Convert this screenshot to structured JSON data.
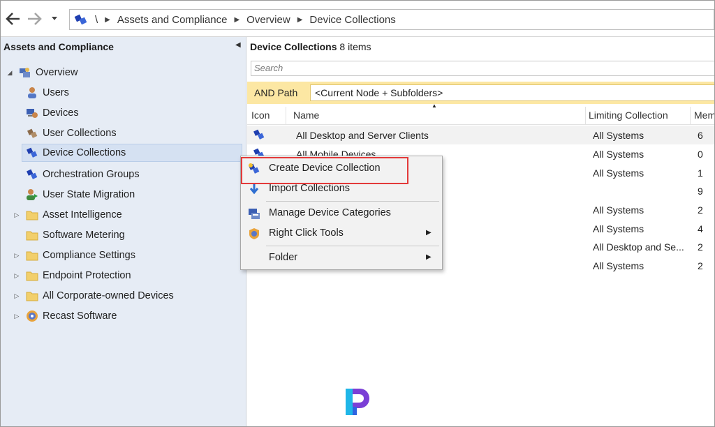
{
  "address_bar": {
    "breadcrumbs": [
      "\\",
      "Assets and Compliance",
      "Overview",
      "Device Collections"
    ]
  },
  "left_pane": {
    "title": "Assets and Compliance",
    "tree": [
      {
        "label": "Overview",
        "icon": "overview-icon",
        "expanded": true,
        "level": 0
      },
      {
        "label": "Users",
        "icon": "users-icon",
        "level": 1
      },
      {
        "label": "Devices",
        "icon": "devices-icon",
        "level": 1
      },
      {
        "label": "User Collections",
        "icon": "user-collections-icon",
        "level": 1
      },
      {
        "label": "Device Collections",
        "icon": "device-collections-icon",
        "level": 1,
        "selected": true
      },
      {
        "label": "Orchestration Groups",
        "icon": "orchestration-groups-icon",
        "level": 1
      },
      {
        "label": "User State Migration",
        "icon": "user-state-migration-icon",
        "level": 1
      },
      {
        "label": "Asset Intelligence",
        "icon": "folder-icon",
        "level": 1,
        "collapsed": true
      },
      {
        "label": "Software Metering",
        "icon": "folder-icon",
        "level": 1
      },
      {
        "label": "Compliance Settings",
        "icon": "folder-icon",
        "level": 1,
        "collapsed": true
      },
      {
        "label": "Endpoint Protection",
        "icon": "folder-icon",
        "level": 1,
        "collapsed": true
      },
      {
        "label": "All Corporate-owned Devices",
        "icon": "folder-icon",
        "level": 1,
        "collapsed": true
      },
      {
        "label": "Recast Software",
        "icon": "recast-icon",
        "level": 1,
        "collapsed": true
      }
    ]
  },
  "right_pane": {
    "title": "Device Collections",
    "count": "8 items",
    "search_placeholder": "Search",
    "filter": {
      "label": "AND Path",
      "value": "<Current Node + Subfolders>"
    },
    "columns": [
      "Icon",
      "Name",
      "Limiting Collection",
      "Mem"
    ],
    "rows": [
      {
        "name": "All Desktop and Server Clients",
        "limiting": "All Systems",
        "members": "6"
      },
      {
        "name": "All Mobile Devices",
        "limiting": "All Systems",
        "members": "0"
      },
      {
        "name": "",
        "limiting": "All Systems",
        "members": "1"
      },
      {
        "name": "",
        "limiting": "",
        "members": "9"
      },
      {
        "name": "",
        "limiting": "All Systems",
        "members": "2"
      },
      {
        "name": "",
        "limiting": "All Systems",
        "members": "4"
      },
      {
        "name": "",
        "limiting": "All Desktop and Se...",
        "members": "2"
      },
      {
        "name": "",
        "limiting": "All Systems",
        "members": "2"
      }
    ]
  },
  "context_menu": {
    "items": [
      {
        "label": "Create Device Collection",
        "icon": "create-collection-icon",
        "highlighted": true
      },
      {
        "label": "Import Collections",
        "icon": "import-arrow-icon"
      },
      {
        "label": "Manage Device Categories",
        "icon": "categories-icon"
      },
      {
        "label": "Right Click Tools",
        "icon": "right-click-tools-icon",
        "submenu": true
      },
      {
        "label": "Folder",
        "icon": "",
        "submenu": true
      }
    ]
  },
  "colors": {
    "accent_filter": "#fce7a3",
    "highlight_border": "#e33a3a",
    "left_pane_bg": "#e6ecf5"
  }
}
